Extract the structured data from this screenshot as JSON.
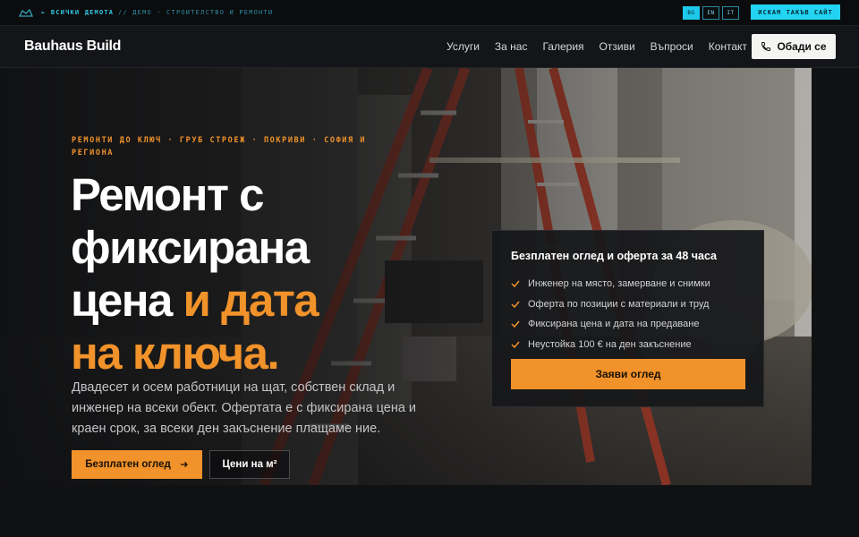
{
  "topbar": {
    "back_label": "← ВСИЧКИ ДЕМОТА",
    "crumb_label": "// ДЕМО · СТРОИТЕЛСТВО И РЕМОНТИ",
    "languages": [
      "BG",
      "EN",
      "IT"
    ],
    "active_language": "BG",
    "want_site_label": "ИСКАМ ТАКЪВ САЙТ"
  },
  "nav": {
    "brand": "Bauhaus Build",
    "menu": [
      "Услуги",
      "За нас",
      "Галерия",
      "Отзиви",
      "Въпроси",
      "Контакт"
    ],
    "call_label": "Обади се"
  },
  "hero": {
    "eyebrow": "РЕМОНТИ ДО КЛЮЧ · ГРУБ СТРОЕЖ · ПОКРИВИ · СОФИЯ И РЕГИОНА",
    "headline_lines": {
      "line1": "Ремонт с",
      "line2": "фиксирана",
      "line3_white": "цена",
      "line3_accent": " и дата",
      "line4_accent": "на ключа."
    },
    "lead": "Двадесет и осем работници на щат, собствен склад и инженер на всеки обект. Офертата е с фиксирана цена и краен срок, за всеки ден закъснение плащаме ние.",
    "primary_button": "Безплатен оглед",
    "secondary_button": "Цени на м²"
  },
  "offer_card": {
    "title": "Безплатен оглед и оферта за 48 часа",
    "items": [
      "Инженер на място, замерване и снимки",
      "Оферта по позиции с материали и труд",
      "Фиксирана цена и дата на предаване",
      "Неустойка 100 € на ден закъснение"
    ],
    "button": "Заяви оглед"
  },
  "colors": {
    "accent": "#f1922a",
    "cyan": "#22d3f2",
    "background": "#101113"
  },
  "icons": [
    "logo-mark-icon",
    "phone-icon",
    "arrow-right-icon",
    "check-icon"
  ]
}
